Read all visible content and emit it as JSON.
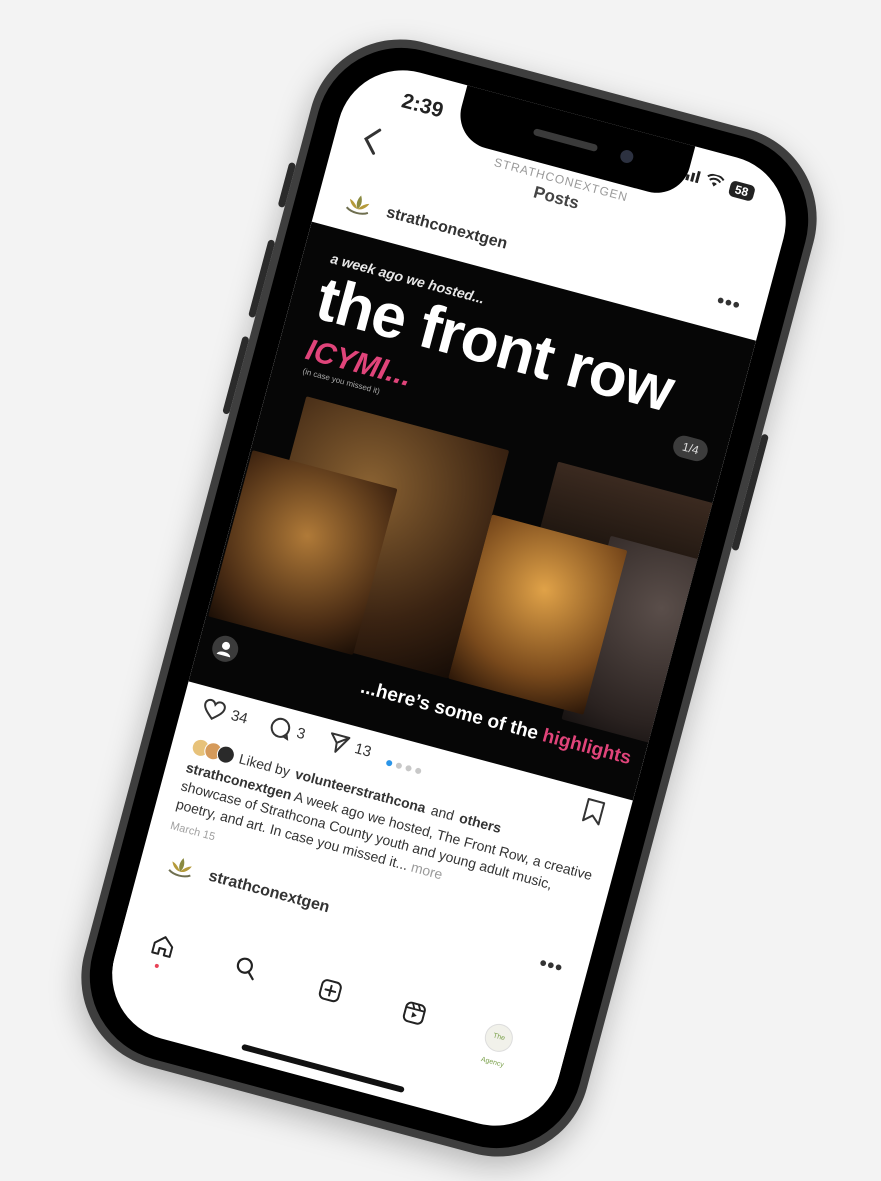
{
  "status_bar": {
    "time": "2:39",
    "battery": "58"
  },
  "header": {
    "back_icon": "chevron-left-icon",
    "account": "STRATHCONEXTGEN",
    "title": "Posts"
  },
  "post": {
    "username": "strathconextgen",
    "page_indicator": "1/4",
    "image": {
      "subtitle": "a week ago we hosted...",
      "title": "the front row",
      "tag": "ICYMI...",
      "tag_sub": "(in case you missed it)",
      "caption_prefix": "...here’s some of the",
      "caption_highlight": "highlights"
    },
    "likes": "34",
    "comments": "3",
    "shares": "13",
    "liked_by_prefix": "Liked by",
    "liked_by_user": "volunteerstrathcona",
    "liked_by_joiner": "and",
    "liked_by_others": "others",
    "caption_user": "strathconextgen",
    "caption_text": "A week ago we hosted, The Front Row, a creative showcase of Strathcona County youth and young adult music, poetry, and art. In case you missed it...",
    "caption_more": "more",
    "date": "March 15",
    "carousel_count": 4,
    "carousel_active": 1
  },
  "next_post": {
    "username": "strathconextgen"
  },
  "tab_bar": {
    "items": [
      "home-icon",
      "search-icon",
      "create-icon",
      "reels-icon",
      "profile-avatar"
    ],
    "profile_thumb_text": "The Agency"
  },
  "colors": {
    "accent_pink": "#e0447a",
    "dot_active": "#2b95e8",
    "notification": "#e84357"
  }
}
